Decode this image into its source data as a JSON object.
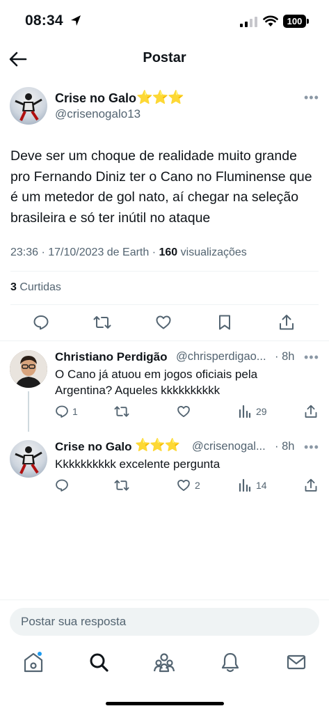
{
  "status_bar": {
    "time": "08:34",
    "battery": "100"
  },
  "header": {
    "title": "Postar"
  },
  "main_tweet": {
    "author_name": "Crise no Galo",
    "author_stars": "⭐⭐⭐",
    "handle": "@crisenogalo13",
    "text": "Deve ser um choque de realidade muito grande pro Fernando Diniz ter o Cano no Fluminense que é um metedor de gol nato, aí chegar na seleção brasileira e só ter inútil no ataque",
    "timestamp": "23:36 · 17/10/2023 de Earth · ",
    "views_count": "160",
    "views_label": " visualizações",
    "likes_count": "3",
    "likes_label": " Curtidas"
  },
  "replies": [
    {
      "author_name": "Christiano Perdigão",
      "handle": "@chrisperdigao...",
      "time": "· 8h",
      "text": "O Cano já atuou em jogos oficiais pela Argentina? Aqueles kkkkkkkkkk",
      "reply_count": "1",
      "retweet_count": "",
      "like_count": "",
      "view_count": "29"
    },
    {
      "author_name": "Crise no Galo",
      "author_stars": "⭐⭐⭐",
      "handle": "@crisenogal...",
      "time": "· 8h",
      "text": "Kkkkkkkkkk excelente pergunta",
      "reply_count": "",
      "retweet_count": "",
      "like_count": "2",
      "view_count": "14"
    }
  ],
  "reply_composer": {
    "placeholder": "Postar sua resposta"
  },
  "colors": {
    "text": "#0f1419",
    "secondary": "#536471",
    "divider": "#eff3f4",
    "accent": "#1d9bf0"
  },
  "icons": {
    "back": "arrow-left-icon",
    "reply": "reply-icon",
    "retweet": "retweet-icon",
    "like": "heart-icon",
    "bookmark": "bookmark-icon",
    "share": "share-icon",
    "views": "views-icon",
    "more": "more-icon",
    "tabs": [
      "home-icon",
      "search-icon",
      "communities-icon",
      "notifications-icon",
      "messages-icon"
    ]
  }
}
